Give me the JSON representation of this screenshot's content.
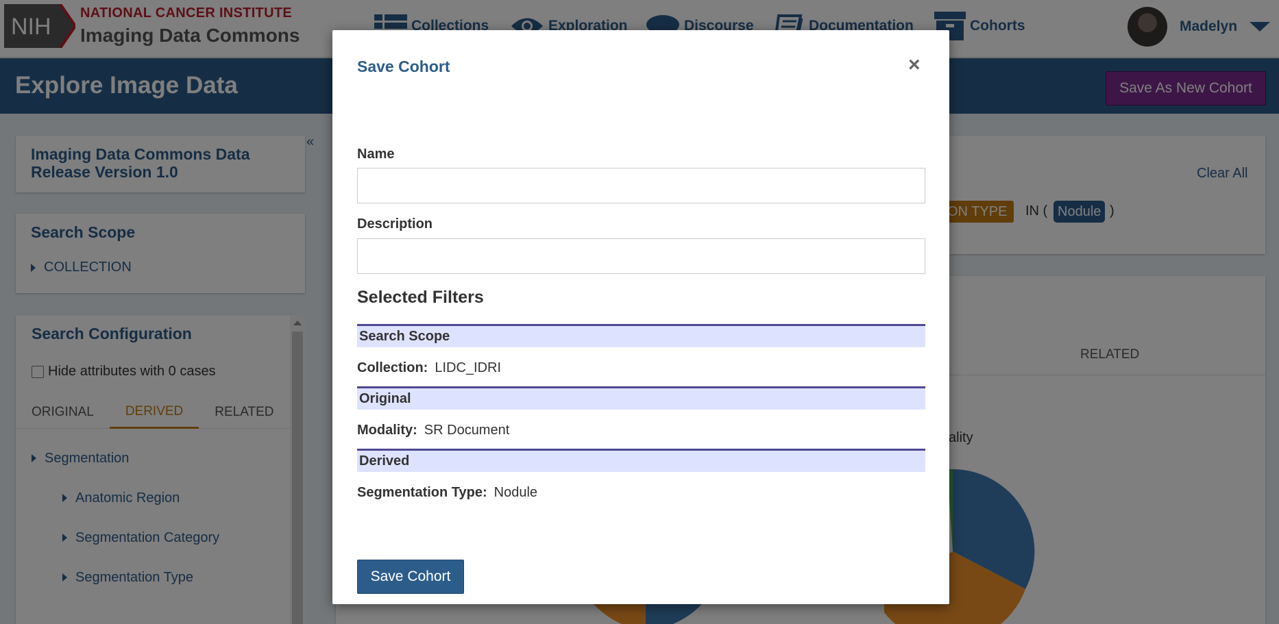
{
  "header": {
    "logo_text": "NIH",
    "org_line1": "NATIONAL CANCER INSTITUTE",
    "org_line2": "Imaging Data Commons",
    "nav": [
      {
        "label": "Collections",
        "icon": "table-icon"
      },
      {
        "label": "Exploration",
        "icon": "eye-icon"
      },
      {
        "label": "Discourse",
        "icon": "chat-bubble-icon"
      },
      {
        "label": "Documentation",
        "icon": "book-icon"
      },
      {
        "label": "Cohorts",
        "icon": "archive-box-icon"
      }
    ],
    "user_name": "Madelyn"
  },
  "titlebar": {
    "title": "Explore Image Data",
    "save_new_label": "Save As New Cohort"
  },
  "sidebar": {
    "release_title": "Imaging Data Commons Data Release Version 1.0",
    "search_scope_title": "Search Scope",
    "search_scope_items": [
      "COLLECTION"
    ],
    "config_title": "Search Configuration",
    "hide_zero_label": "Hide attributes with 0 cases",
    "tabs": [
      "ORIGINAL",
      "DERIVED",
      "RELATED"
    ],
    "active_tab": "DERIVED",
    "tree": [
      {
        "label": "Segmentation",
        "level": 0
      },
      {
        "label": "Anatomic Region",
        "level": 1
      },
      {
        "label": "Segmentation Category",
        "level": 1
      },
      {
        "label": "Segmentation Type",
        "level": 1
      }
    ]
  },
  "filters_panel": {
    "clear_all_label": "Clear All",
    "chip_type_visible": "ON TYPE",
    "chip_in": "IN (",
    "chip_value": "Nodule",
    "chip_close": ")"
  },
  "charts_panel": {
    "related_tab": "RELATED",
    "chart_label_visible": "ality"
  },
  "modal": {
    "title": "Save Cohort",
    "close_symbol": "×",
    "name_label": "Name",
    "name_value": "",
    "description_label": "Description",
    "description_value": "",
    "selected_filters_title": "Selected Filters",
    "groups": [
      {
        "heading": "Search Scope",
        "rows": [
          {
            "key": "Collection:",
            "value": "LIDC_IDRI"
          }
        ]
      },
      {
        "heading": "Original",
        "rows": [
          {
            "key": "Modality:",
            "value": "SR Document"
          }
        ]
      },
      {
        "heading": "Derived",
        "rows": [
          {
            "key": "Segmentation Type:",
            "value": "Nodule"
          }
        ]
      }
    ],
    "save_label": "Save Cohort"
  },
  "colors": {
    "brand_blue": "#2c5d8a",
    "nci_red": "#bd1f2d",
    "accent_orange": "#c27a14",
    "purple_button": "#7a2c8e",
    "filter_head_bg": "#dde3ff",
    "filter_head_border": "#4f4893"
  }
}
